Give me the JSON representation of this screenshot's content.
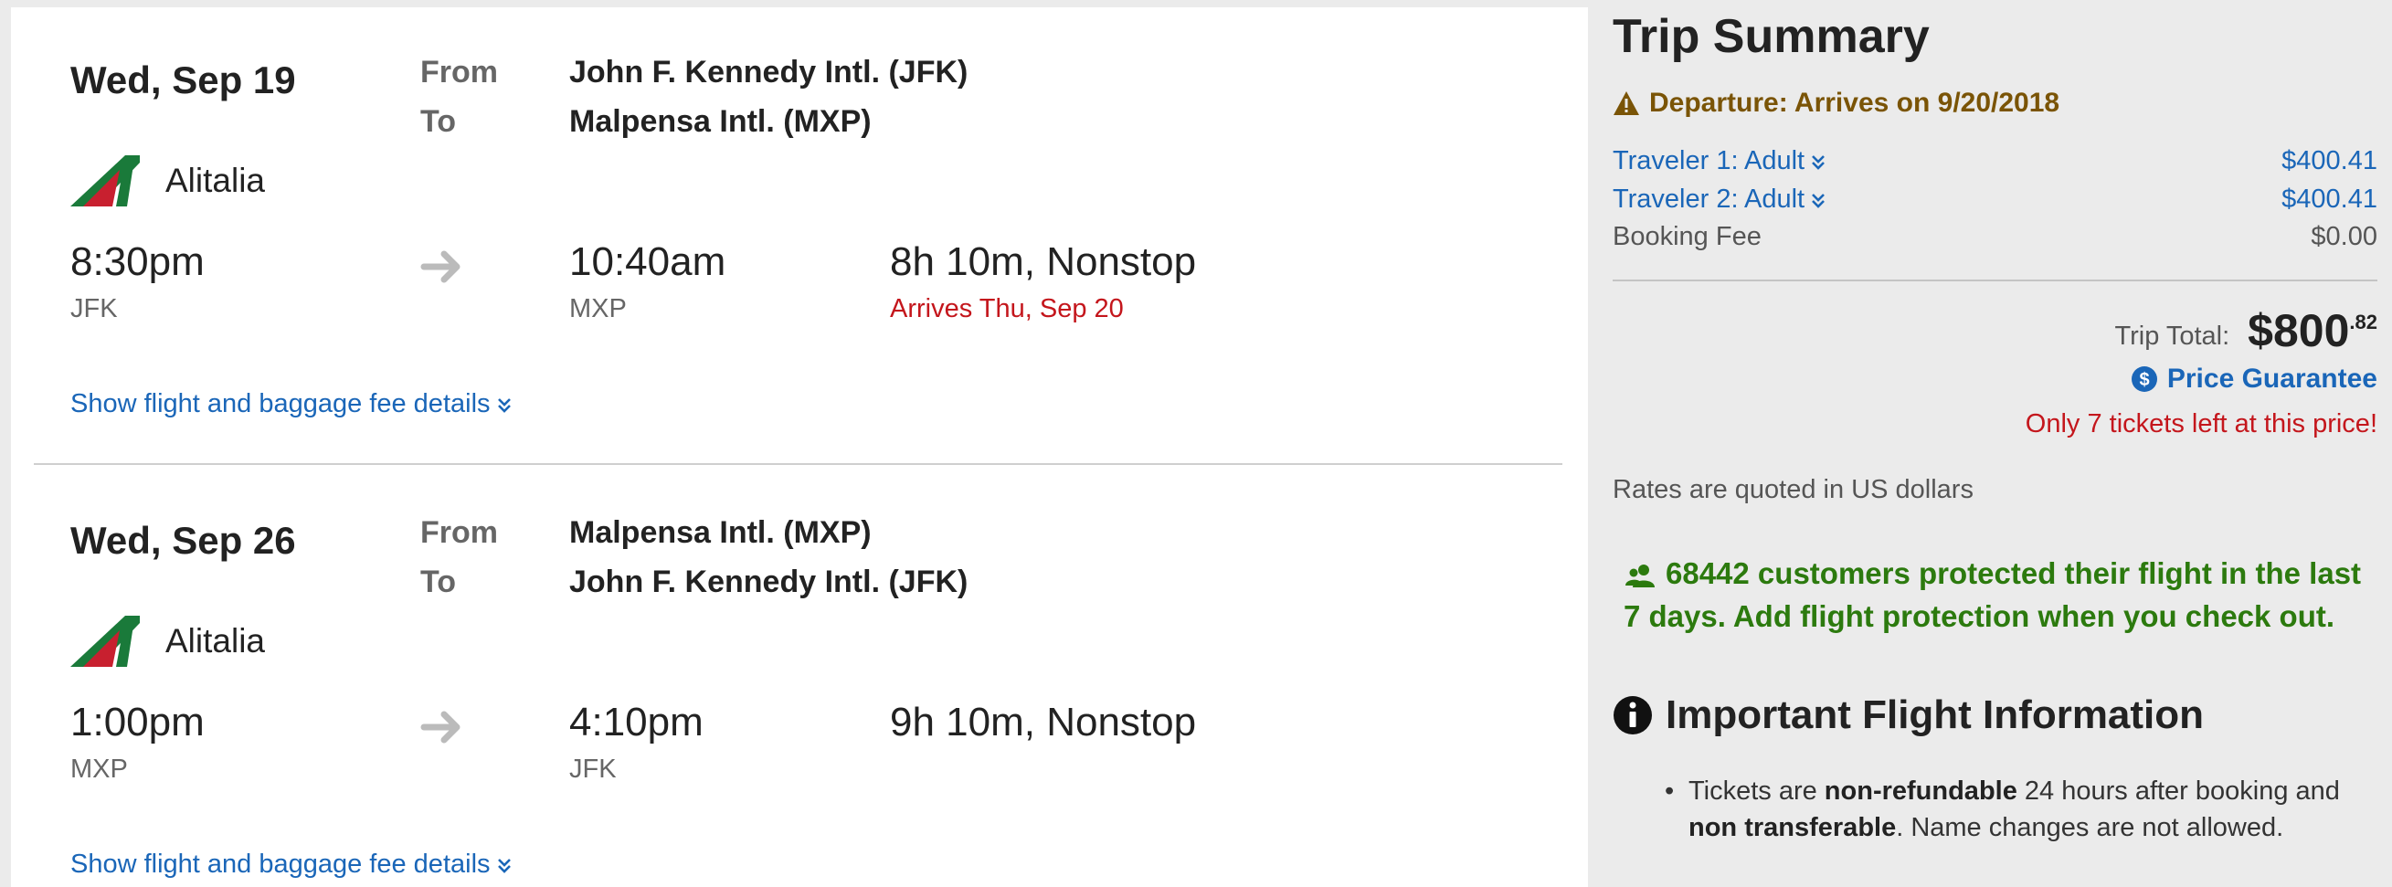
{
  "legs": [
    {
      "date": "Wed, Sep 19",
      "from_label": "From",
      "to_label": "To",
      "from_airport": "John F. Kennedy Intl. (JFK)",
      "to_airport": "Malpensa Intl. (MXP)",
      "airline": "Alitalia",
      "depart_time": "8:30pm",
      "depart_code": "JFK",
      "arrive_time": "10:40am",
      "arrive_code": "MXP",
      "duration": "8h 10m, Nonstop",
      "arrival_note": "Arrives Thu, Sep 20",
      "details_link": "Show flight and baggage fee details"
    },
    {
      "date": "Wed, Sep 26",
      "from_label": "From",
      "to_label": "To",
      "from_airport": "Malpensa Intl. (MXP)",
      "to_airport": "John F. Kennedy Intl. (JFK)",
      "airline": "Alitalia",
      "depart_time": "1:00pm",
      "depart_code": "MXP",
      "arrive_time": "4:10pm",
      "arrive_code": "JFK",
      "duration": "9h 10m, Nonstop",
      "details_link": "Show flight and baggage fee details"
    }
  ],
  "summary": {
    "title": "Trip Summary",
    "departure_warning": "Departure: Arrives on 9/20/2018",
    "travelers": [
      {
        "label": "Traveler 1: Adult",
        "amount": "$400.41"
      },
      {
        "label": "Traveler 2: Adult",
        "amount": "$400.41"
      }
    ],
    "booking_fee": {
      "label": "Booking Fee",
      "amount": "$0.00"
    },
    "trip_total": {
      "label": "Trip Total:",
      "dollars": "$800",
      "cents": ".82"
    },
    "price_guarantee": "Price Guarantee",
    "tickets_left": "Only 7 tickets left at this price!",
    "rates_note": "Rates are quoted in US dollars",
    "protection_note": "68442 customers protected their flight in the last 7 days. Add flight protection when you check out.",
    "important_heading": "Important Flight Information",
    "info_item": {
      "part1": "Tickets are ",
      "bold1": "non-refundable",
      "part2": " 24 hours after booking and ",
      "bold2": "non transferable",
      "part3": ". Name changes are not allowed."
    }
  },
  "colors": {
    "link_blue": "#1a66b8",
    "alert_red": "#c4161c",
    "warning_brown": "#7a5406",
    "protection_green": "#2c7a0e",
    "alitalia_green": "#1a7a3a",
    "alitalia_red": "#c8202f"
  },
  "icons": [
    "alitalia-logo",
    "arrow-right-icon",
    "chevron-double-down-icon",
    "warning-icon",
    "dollar-circle-icon",
    "users-icon",
    "info-icon"
  ]
}
